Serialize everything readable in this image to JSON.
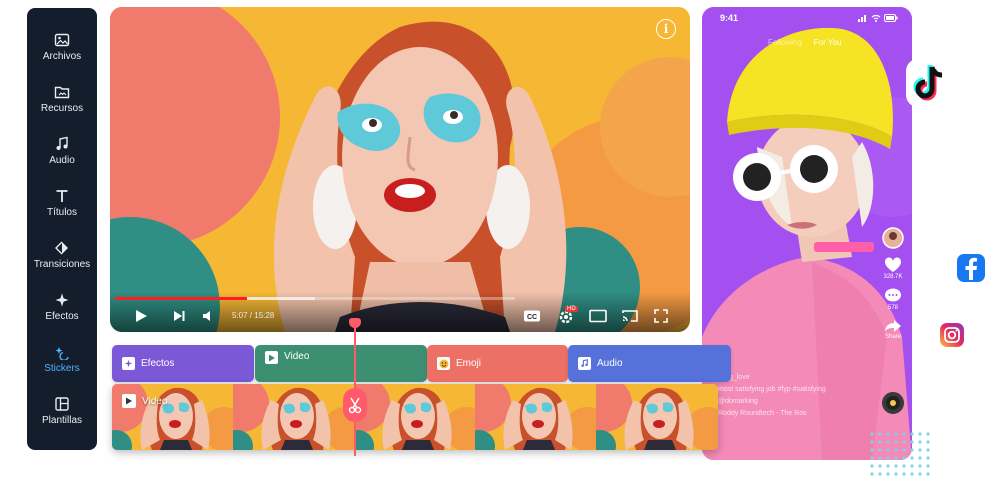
{
  "sidebar": {
    "items": [
      {
        "label": "Archivos",
        "icon": "image-icon"
      },
      {
        "label": "Recursos",
        "icon": "folder-icon"
      },
      {
        "label": "Audio",
        "icon": "music-note-icon"
      },
      {
        "label": "Títulos",
        "icon": "text-icon"
      },
      {
        "label": "Transiciones",
        "icon": "transition-icon"
      },
      {
        "label": "Efectos",
        "icon": "sparkle-icon"
      },
      {
        "label": "Stickers",
        "icon": "sticker-icon"
      },
      {
        "label": "Plantillas",
        "icon": "template-icon"
      }
    ],
    "active": "Stickers",
    "active_color": "#4fb3ff"
  },
  "player": {
    "time": "5:07 / 15:28",
    "progress": 0.33,
    "buffered": 0.5,
    "info_label": "i",
    "hd_badge": "HD"
  },
  "phone": {
    "status_time": "9:41",
    "tabs": [
      "Following",
      "For You"
    ],
    "likes": "328.7K",
    "comments": "578",
    "share": "Share",
    "caption_lines": [
      "@_g_love",
      "most satisfying job #fyp #satisfying",
      "@domarking",
      "Roddy Roundtech - The Ros"
    ]
  },
  "tracks": [
    {
      "label": "Efectos",
      "color": "#7b58d6",
      "icon": "sparkle-icon"
    },
    {
      "label": "Video",
      "color": "#3c9071",
      "icon": "play-icon"
    },
    {
      "label": "Emoji",
      "color": "#ed7066",
      "icon": "emoji-icon"
    },
    {
      "label": "Audio",
      "color": "#5671d9",
      "icon": "music-note-icon"
    }
  ],
  "filmstrip": {
    "label": "Video"
  },
  "social": [
    "tiktok-icon",
    "facebook-icon",
    "instagram-icon"
  ]
}
